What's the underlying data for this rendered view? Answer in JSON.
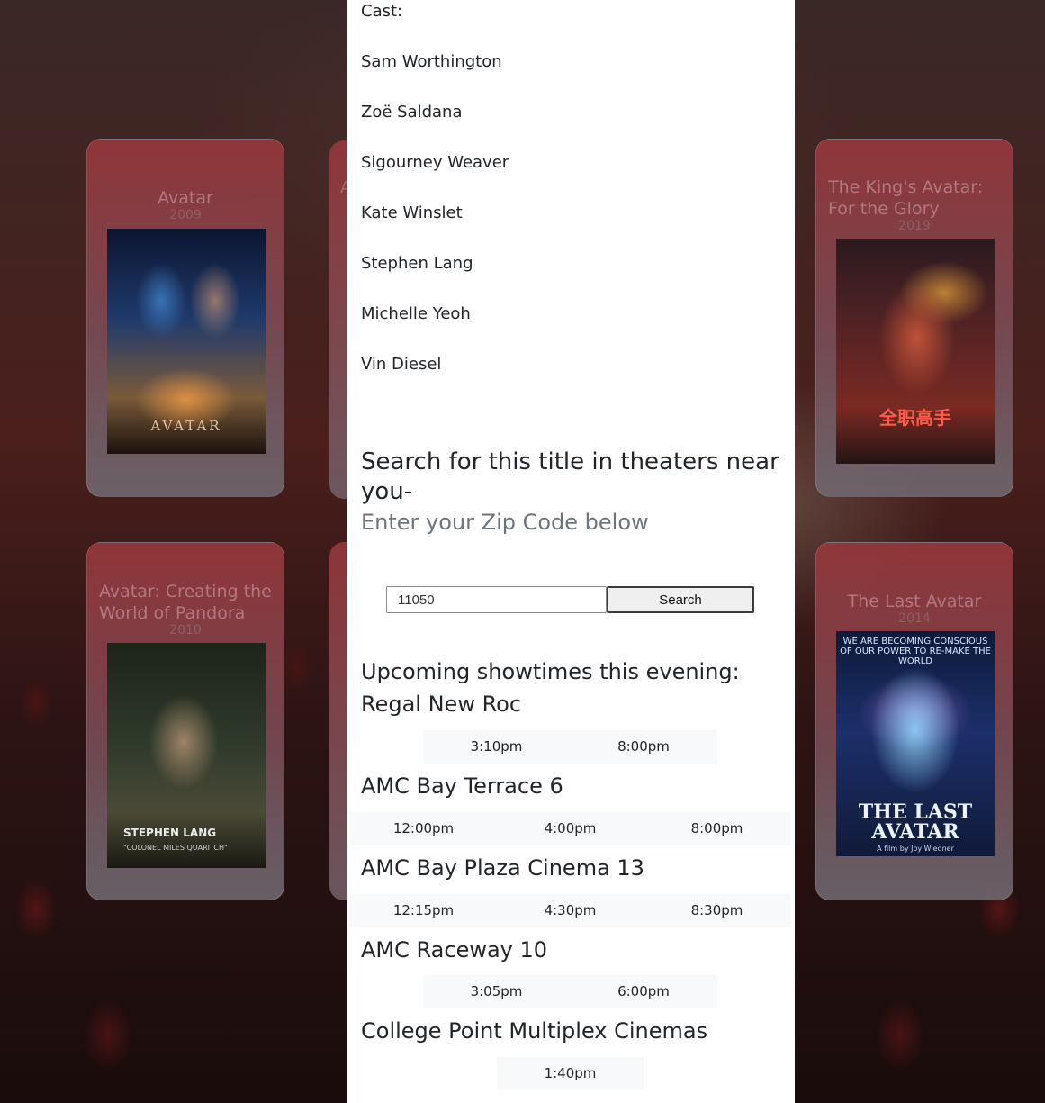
{
  "cards": [
    {
      "title": "Avatar",
      "year": "2009",
      "poster_text": "AVATAR"
    },
    {
      "title": "Avatar: Creating the World of Pandora",
      "year": "2010",
      "poster_text": "STEPHEN LANG",
      "poster_sub": "\"COLONEL MILES QUARITCH\""
    },
    {
      "title": "The King's Avatar: For the Glory",
      "year": "2019",
      "poster_text": "全职高手"
    },
    {
      "title": "The Last Avatar",
      "year": "2014",
      "poster_top": "WE ARE BECOMING CONSCIOUS OF OUR POWER TO RE-MAKE THE WORLD",
      "poster_text": "THE LAST AVATAR",
      "poster_sub": "A film by Joy Wiedner"
    }
  ],
  "partial_cards": [
    {
      "glyph": "A"
    },
    {
      "glyph": ""
    }
  ],
  "modal": {
    "cast_label": "Cast:",
    "cast": [
      "Sam Worthington",
      "Zoë Saldana",
      "Sigourney Weaver",
      "Kate Winslet",
      "Stephen Lang",
      "Michelle Yeoh",
      "Vin Diesel"
    ],
    "search_heading": "Search for this title in theaters near you-",
    "search_sub": "Enter your Zip Code below",
    "zip_value": "11050",
    "search_button": "Search",
    "upcoming_heading": "Upcoming showtimes this evening:",
    "theaters": [
      {
        "name": "Regal New Roc",
        "times": [
          "3:10pm",
          "8:00pm"
        ]
      },
      {
        "name": "AMC Bay Terrace 6",
        "times": [
          "12:00pm",
          "4:00pm",
          "8:00pm"
        ]
      },
      {
        "name": "AMC Bay Plaza Cinema 13",
        "times": [
          "12:15pm",
          "4:30pm",
          "8:30pm"
        ]
      },
      {
        "name": "AMC Raceway 10",
        "times": [
          "3:05pm",
          "6:00pm"
        ]
      },
      {
        "name": "College Point Multiplex Cinemas",
        "times": [
          "1:40pm"
        ]
      }
    ]
  }
}
